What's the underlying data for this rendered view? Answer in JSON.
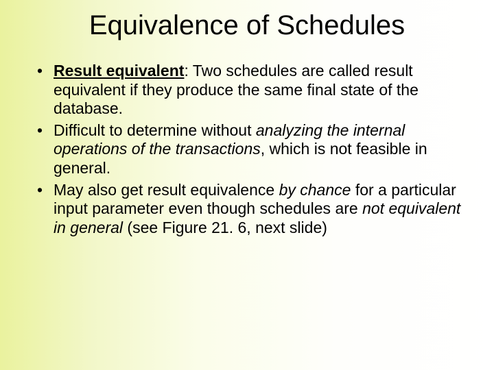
{
  "title": "Equivalence of Schedules",
  "bullets": [
    {
      "segments": [
        {
          "text": "Result equivalent",
          "cls": "bu"
        },
        {
          "text": ": Two schedules are called result equivalent if they produce the same final state of the database.",
          "cls": ""
        }
      ]
    },
    {
      "segments": [
        {
          "text": "Difficult to determine without ",
          "cls": ""
        },
        {
          "text": "analyzing the internal operations of the transactions",
          "cls": "i"
        },
        {
          "text": ", which is not feasible in general.",
          "cls": ""
        }
      ]
    },
    {
      "segments": [
        {
          "text": "May also get result equivalence ",
          "cls": ""
        },
        {
          "text": "by chance",
          "cls": "i"
        },
        {
          "text": " for a particular input parameter even though schedules are ",
          "cls": ""
        },
        {
          "text": "not equivalent in general",
          "cls": "i"
        },
        {
          "text": " (see Figure 21. 6, next slide)",
          "cls": ""
        }
      ]
    }
  ]
}
